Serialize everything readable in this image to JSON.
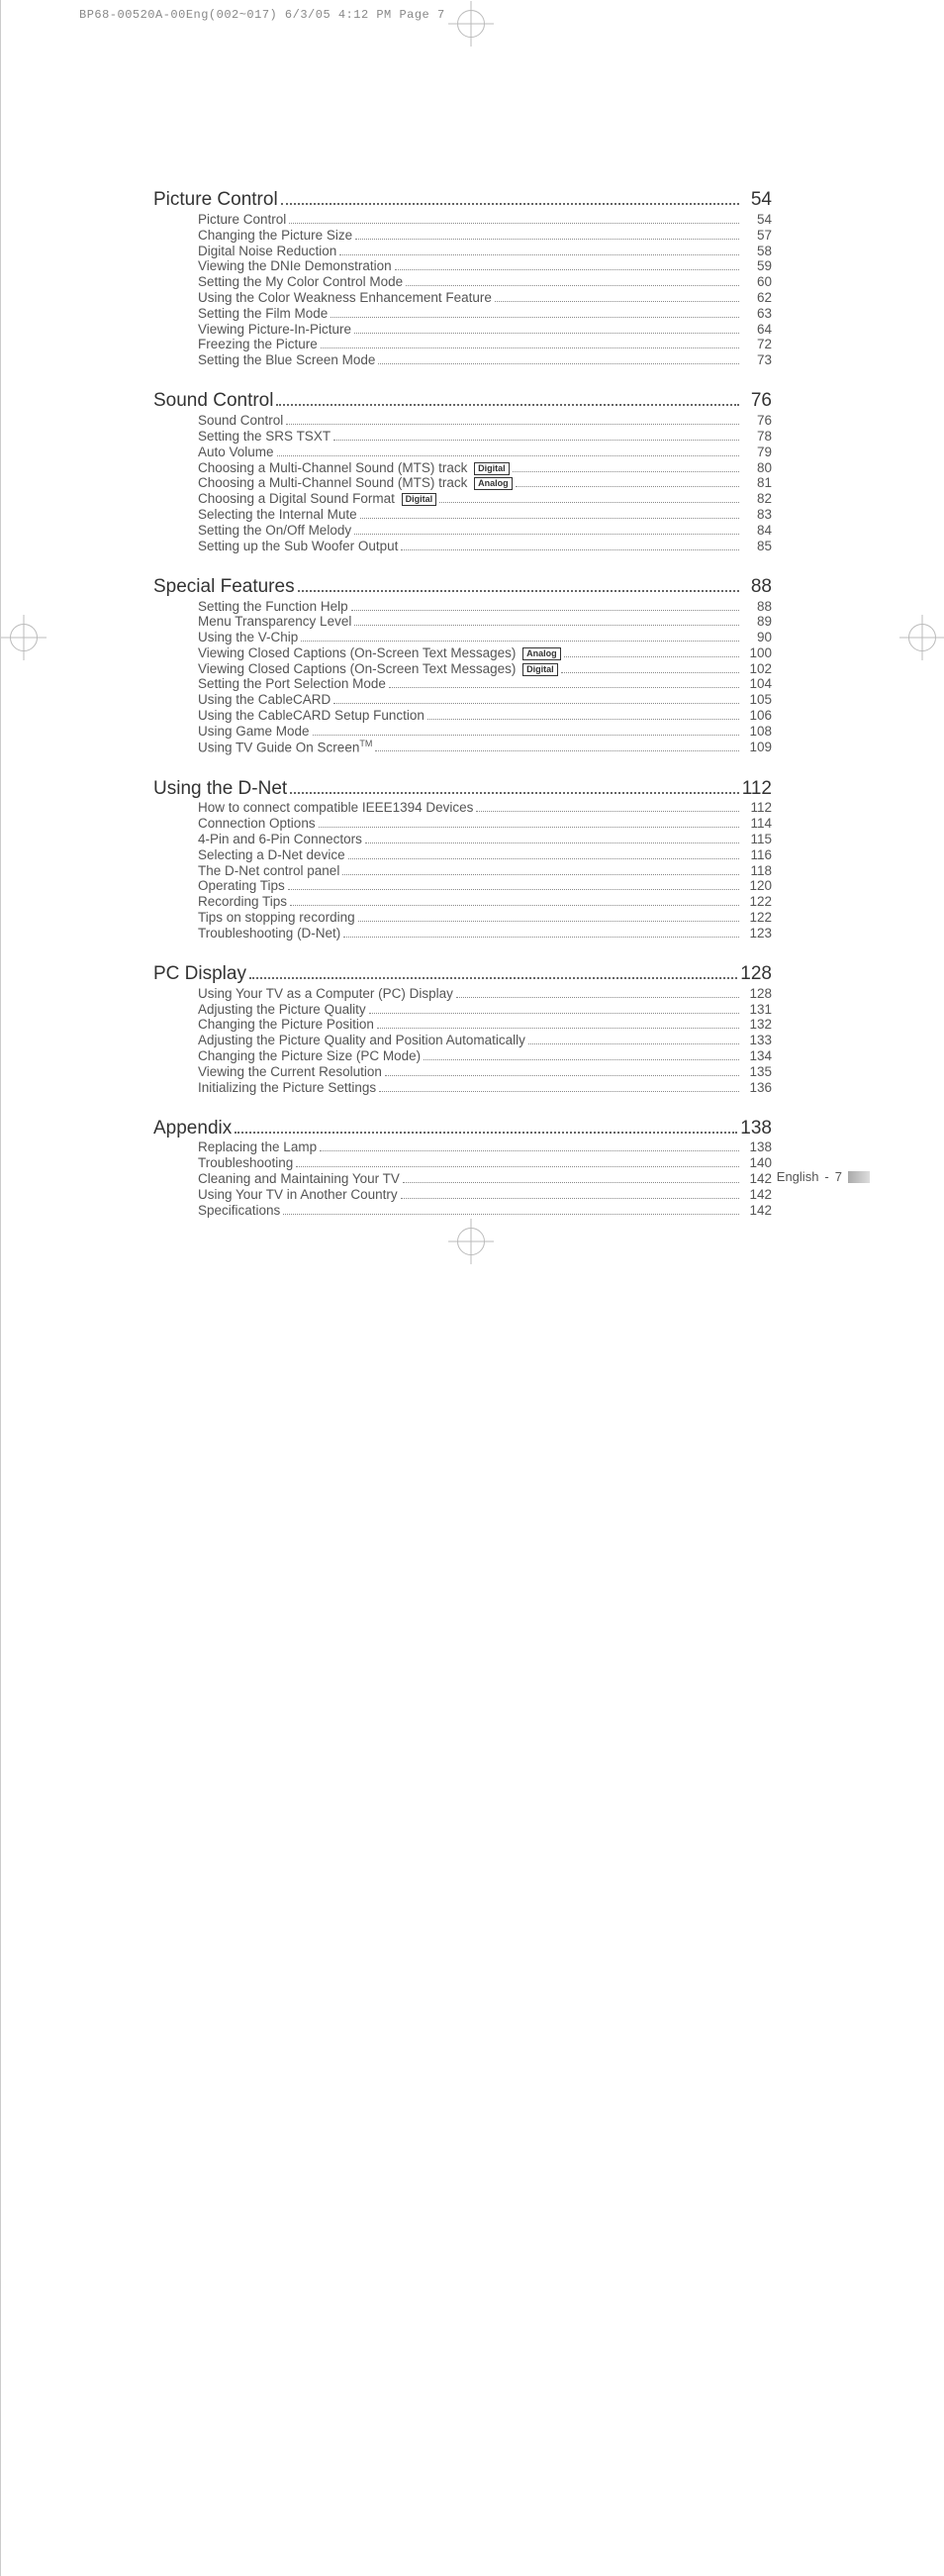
{
  "header_line": "BP68-00520A-00Eng(002~017)  6/3/05  4:12 PM  Page 7",
  "footer": {
    "lang": "English",
    "sep": "-",
    "page": "7"
  },
  "sections": [
    {
      "title": "Picture Control",
      "page": "54",
      "items": [
        {
          "t": "Picture Control",
          "p": "54"
        },
        {
          "t": "Changing the Picture Size",
          "p": "57"
        },
        {
          "t": "Digital Noise Reduction",
          "p": "58"
        },
        {
          "t": "Viewing the DNIe Demonstration",
          "p": "59"
        },
        {
          "t": "Setting the My Color Control Mode",
          "p": "60"
        },
        {
          "t": "Using the Color Weakness Enhancement Feature",
          "p": "62"
        },
        {
          "t": "Setting the Film Mode",
          "p": "63"
        },
        {
          "t": "Viewing Picture-In-Picture",
          "p": "64"
        },
        {
          "t": "Freezing the Picture",
          "p": "72"
        },
        {
          "t": "Setting the Blue Screen Mode",
          "p": "73"
        }
      ]
    },
    {
      "title": "Sound Control",
      "page": "76",
      "items": [
        {
          "t": "Sound Control",
          "p": "76"
        },
        {
          "t": "Setting the SRS TSXT",
          "p": "78"
        },
        {
          "t": "Auto Volume",
          "p": "79"
        },
        {
          "t": "Choosing a Multi-Channel Sound (MTS) track",
          "p": "80",
          "tag": "Digital"
        },
        {
          "t": "Choosing a Multi-Channel Sound (MTS) track",
          "p": "81",
          "tag": "Analog"
        },
        {
          "t": "Choosing a Digital Sound Format",
          "p": "82",
          "tag": "Digital"
        },
        {
          "t": "Selecting the Internal Mute",
          "p": "83"
        },
        {
          "t": "Setting the On/Off Melody",
          "p": "84"
        },
        {
          "t": "Setting up the Sub Woofer Output",
          "p": "85"
        }
      ]
    },
    {
      "title": "Special Features",
      "page": "88",
      "items": [
        {
          "t": "Setting the Function Help",
          "p": "88"
        },
        {
          "t": "Menu Transparency Level",
          "p": "89"
        },
        {
          "t": "Using the V-Chip",
          "p": "90"
        },
        {
          "t": "Viewing Closed Captions (On-Screen Text Messages)",
          "p": "100",
          "tag": "Analog"
        },
        {
          "t": "Viewing Closed Captions (On-Screen Text Messages)",
          "p": "102",
          "tag": "Digital"
        },
        {
          "t": "Setting the Port Selection Mode",
          "p": "104"
        },
        {
          "t": "Using the CableCARD",
          "p": "105"
        },
        {
          "t": "Using the CableCARD Setup Function",
          "p": "106"
        },
        {
          "t": "Using Game Mode",
          "p": "108"
        },
        {
          "t": "Using TV Guide On Screen",
          "p": "109",
          "tm": true
        }
      ]
    },
    {
      "title": "Using the D-Net",
      "page": "112",
      "items": [
        {
          "t": "How to connect compatible IEEE1394 Devices",
          "p": "112"
        },
        {
          "t": "Connection Options",
          "p": "114"
        },
        {
          "t": "4-Pin and 6-Pin Connectors",
          "p": "115"
        },
        {
          "t": "Selecting a D-Net device",
          "p": "116"
        },
        {
          "t": "The D-Net control panel",
          "p": "118"
        },
        {
          "t": "Operating Tips",
          "p": "120"
        },
        {
          "t": "Recording Tips",
          "p": "122"
        },
        {
          "t": "Tips on stopping recording",
          "p": "122"
        },
        {
          "t": "Troubleshooting (D-Net)",
          "p": "123"
        }
      ]
    },
    {
      "title": "PC Display",
      "page": "128",
      "items": [
        {
          "t": "Using Your TV as a Computer (PC) Display",
          "p": "128"
        },
        {
          "t": "Adjusting the Picture Quality",
          "p": "131"
        },
        {
          "t": "Changing the Picture Position",
          "p": "132"
        },
        {
          "t": "Adjusting the Picture Quality and Position Automatically",
          "p": "133"
        },
        {
          "t": "Changing the Picture Size (PC Mode)",
          "p": "134"
        },
        {
          "t": "Viewing the Current Resolution",
          "p": "135"
        },
        {
          "t": "Initializing the Picture Settings",
          "p": "136"
        }
      ]
    },
    {
      "title": "Appendix",
      "page": "138",
      "items": [
        {
          "t": "Replacing the Lamp",
          "p": "138"
        },
        {
          "t": "Troubleshooting",
          "p": "140"
        },
        {
          "t": "Cleaning and Maintaining Your TV",
          "p": "142"
        },
        {
          "t": "Using Your TV in Another Country",
          "p": "142"
        },
        {
          "t": "Specifications",
          "p": "142"
        }
      ]
    }
  ]
}
